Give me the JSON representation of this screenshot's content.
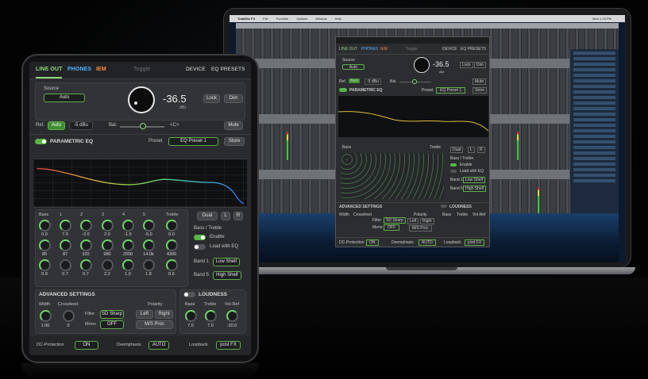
{
  "app": {
    "tabs": {
      "line_out": "LINE OUT",
      "phones": "PHONES",
      "iem": "IEM",
      "toggle": "Toggle",
      "device": "DEVICE",
      "eq_presets": "EQ PRESETS"
    },
    "source": {
      "label": "Source",
      "value": "Auto"
    },
    "volume": {
      "value": "-36.5",
      "unit": "dBr",
      "lock": "Lock",
      "dim": "Dim",
      "mute": "Mute"
    },
    "ref": {
      "label": "Ref.",
      "auto": "Auto",
      "level": "-5 dBu",
      "bal_label": "Bal.",
      "bal_value": "<C>"
    },
    "peq": {
      "title": "PARAMETRIC EQ",
      "preset_label": "Preset",
      "preset_value": "EQ Preset 1",
      "store": "Store",
      "enabled": true
    },
    "bands": {
      "headers": [
        "Bass",
        "1",
        "2",
        "3",
        "4",
        "5",
        "Treble"
      ],
      "gains": [
        "0.0",
        "7.0",
        "-2.0",
        "2.0",
        "-1.5",
        "-5.0",
        "0.0"
      ],
      "freqs": [
        "85",
        "87",
        "320",
        "980",
        "2000",
        "14.0k",
        "4300"
      ],
      "qs": [
        "0.9",
        "0.7",
        "0.7",
        "2.2",
        "1.0",
        "1.8",
        "0.6"
      ]
    },
    "eq_mode": {
      "dual": "Dual",
      "l": "L",
      "r": "R"
    },
    "bass_treble": {
      "title": "Bass / Treble",
      "enable": "Enable",
      "load_with_eq": "Load with EQ",
      "band1_label": "Band 1",
      "band1_value": "Low Shelf",
      "band5_label": "Band 5",
      "band5_value": "High Shelf"
    },
    "advanced": {
      "title": "ADVANCED SETTINGS",
      "width_label": "Width",
      "width_value": "1.00",
      "crossfeed_label": "Crossfeed",
      "crossfeed_value": "0",
      "filter_label": "Filter",
      "filter_value": "SD Sharp",
      "mono_label": "Mono",
      "mono_value": "OFF",
      "polarity_label": "Polarity",
      "left": "Left",
      "right": "Right",
      "ms_proc": "M/S Proc"
    },
    "loudness": {
      "title": "LOUDNESS",
      "bass_label": "Bass",
      "bass_value": "7.0",
      "treble_label": "Treble",
      "treble_value": "7.0",
      "volref_label": "Vol-Ref",
      "volref_value": "-30.0"
    },
    "footer": {
      "dc_label": "DC-Protection",
      "dc_value": "ON",
      "deemph_label": "Deemphasis",
      "deemph_value": "AUTO",
      "loopback_label": "Loopback",
      "loopback_value": "post FX"
    }
  },
  "mini": {
    "tabs": {
      "line_out": "LINE OUT",
      "phones": "PHONES",
      "iem": "IEM",
      "toggle": "Toggle",
      "device": "DEVICE",
      "eq_presets": "EQ PRESETS"
    },
    "source_label": "Source",
    "source_value": "Auto",
    "volume": "-36.5",
    "unit": "dBr",
    "lock": "Lock",
    "dim": "Dim",
    "ref_label": "Ref.",
    "ref_auto": "Auto",
    "ref_level": "-5 dBu",
    "bal_label": "Bal.",
    "mute": "Mute",
    "peq": "PARAMETRIC EQ",
    "preset_label": "Preset",
    "preset_value": "EQ Preset 1",
    "store": "Store",
    "dual": "Dual",
    "l": "L",
    "r": "R",
    "bass_treble": "Bass / Treble",
    "enable": "Enable",
    "load_with_eq": "Load with EQ",
    "band1": "Band 1",
    "low_shelf": "Low Shelf",
    "band5": "Band 5",
    "high_shelf": "High Shelf",
    "advanced": "ADVANCED SETTINGS",
    "loudness": "LOUDNESS",
    "width": "Width",
    "crossfeed": "Crossfeed",
    "filter": "Filter",
    "filter_value": "SD Sharp",
    "mono": "Mono",
    "mono_value": "OFF",
    "polarity": "Polarity",
    "left": "Left",
    "right": "Right",
    "ms_proc": "M/S Proc",
    "bass": "Bass",
    "treble": "Treble",
    "volref": "Vol-Ref",
    "dc": "DC-Protection",
    "dc_value": "ON",
    "deemph": "Deemphasis",
    "deemph_value": "AUTO",
    "loopback": "Loopback",
    "loopback_value": "post FX"
  },
  "mac_menu": {
    "app": "TotalMix FX",
    "items": [
      "File",
      "Function",
      "Options",
      "Window",
      "Help"
    ],
    "right": "Wed 1:15 PM"
  },
  "colors": {
    "green": "#8fd87a",
    "blue": "#4fb0ff",
    "orange": "#ff8a3a",
    "panel": "#323337"
  }
}
